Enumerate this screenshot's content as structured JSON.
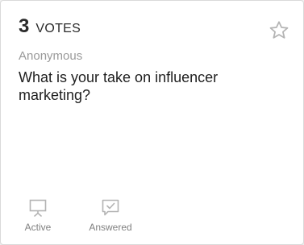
{
  "card": {
    "vote_count": "3",
    "vote_label": "VOTES",
    "author": "Anonymous",
    "question": "What is your take on influencer marketing?",
    "icons": {
      "favorite": "star-outline-icon",
      "active": "presentation-board-icon",
      "answered": "chat-check-icon"
    }
  },
  "actions": {
    "active_label": "Active",
    "answered_label": "Answered"
  },
  "colors": {
    "card_background": "#ffffff",
    "card_border": "#dadada",
    "text_primary": "#1e1e1e",
    "text_muted": "#9a9a9a",
    "icon": "#b4b4b4"
  }
}
